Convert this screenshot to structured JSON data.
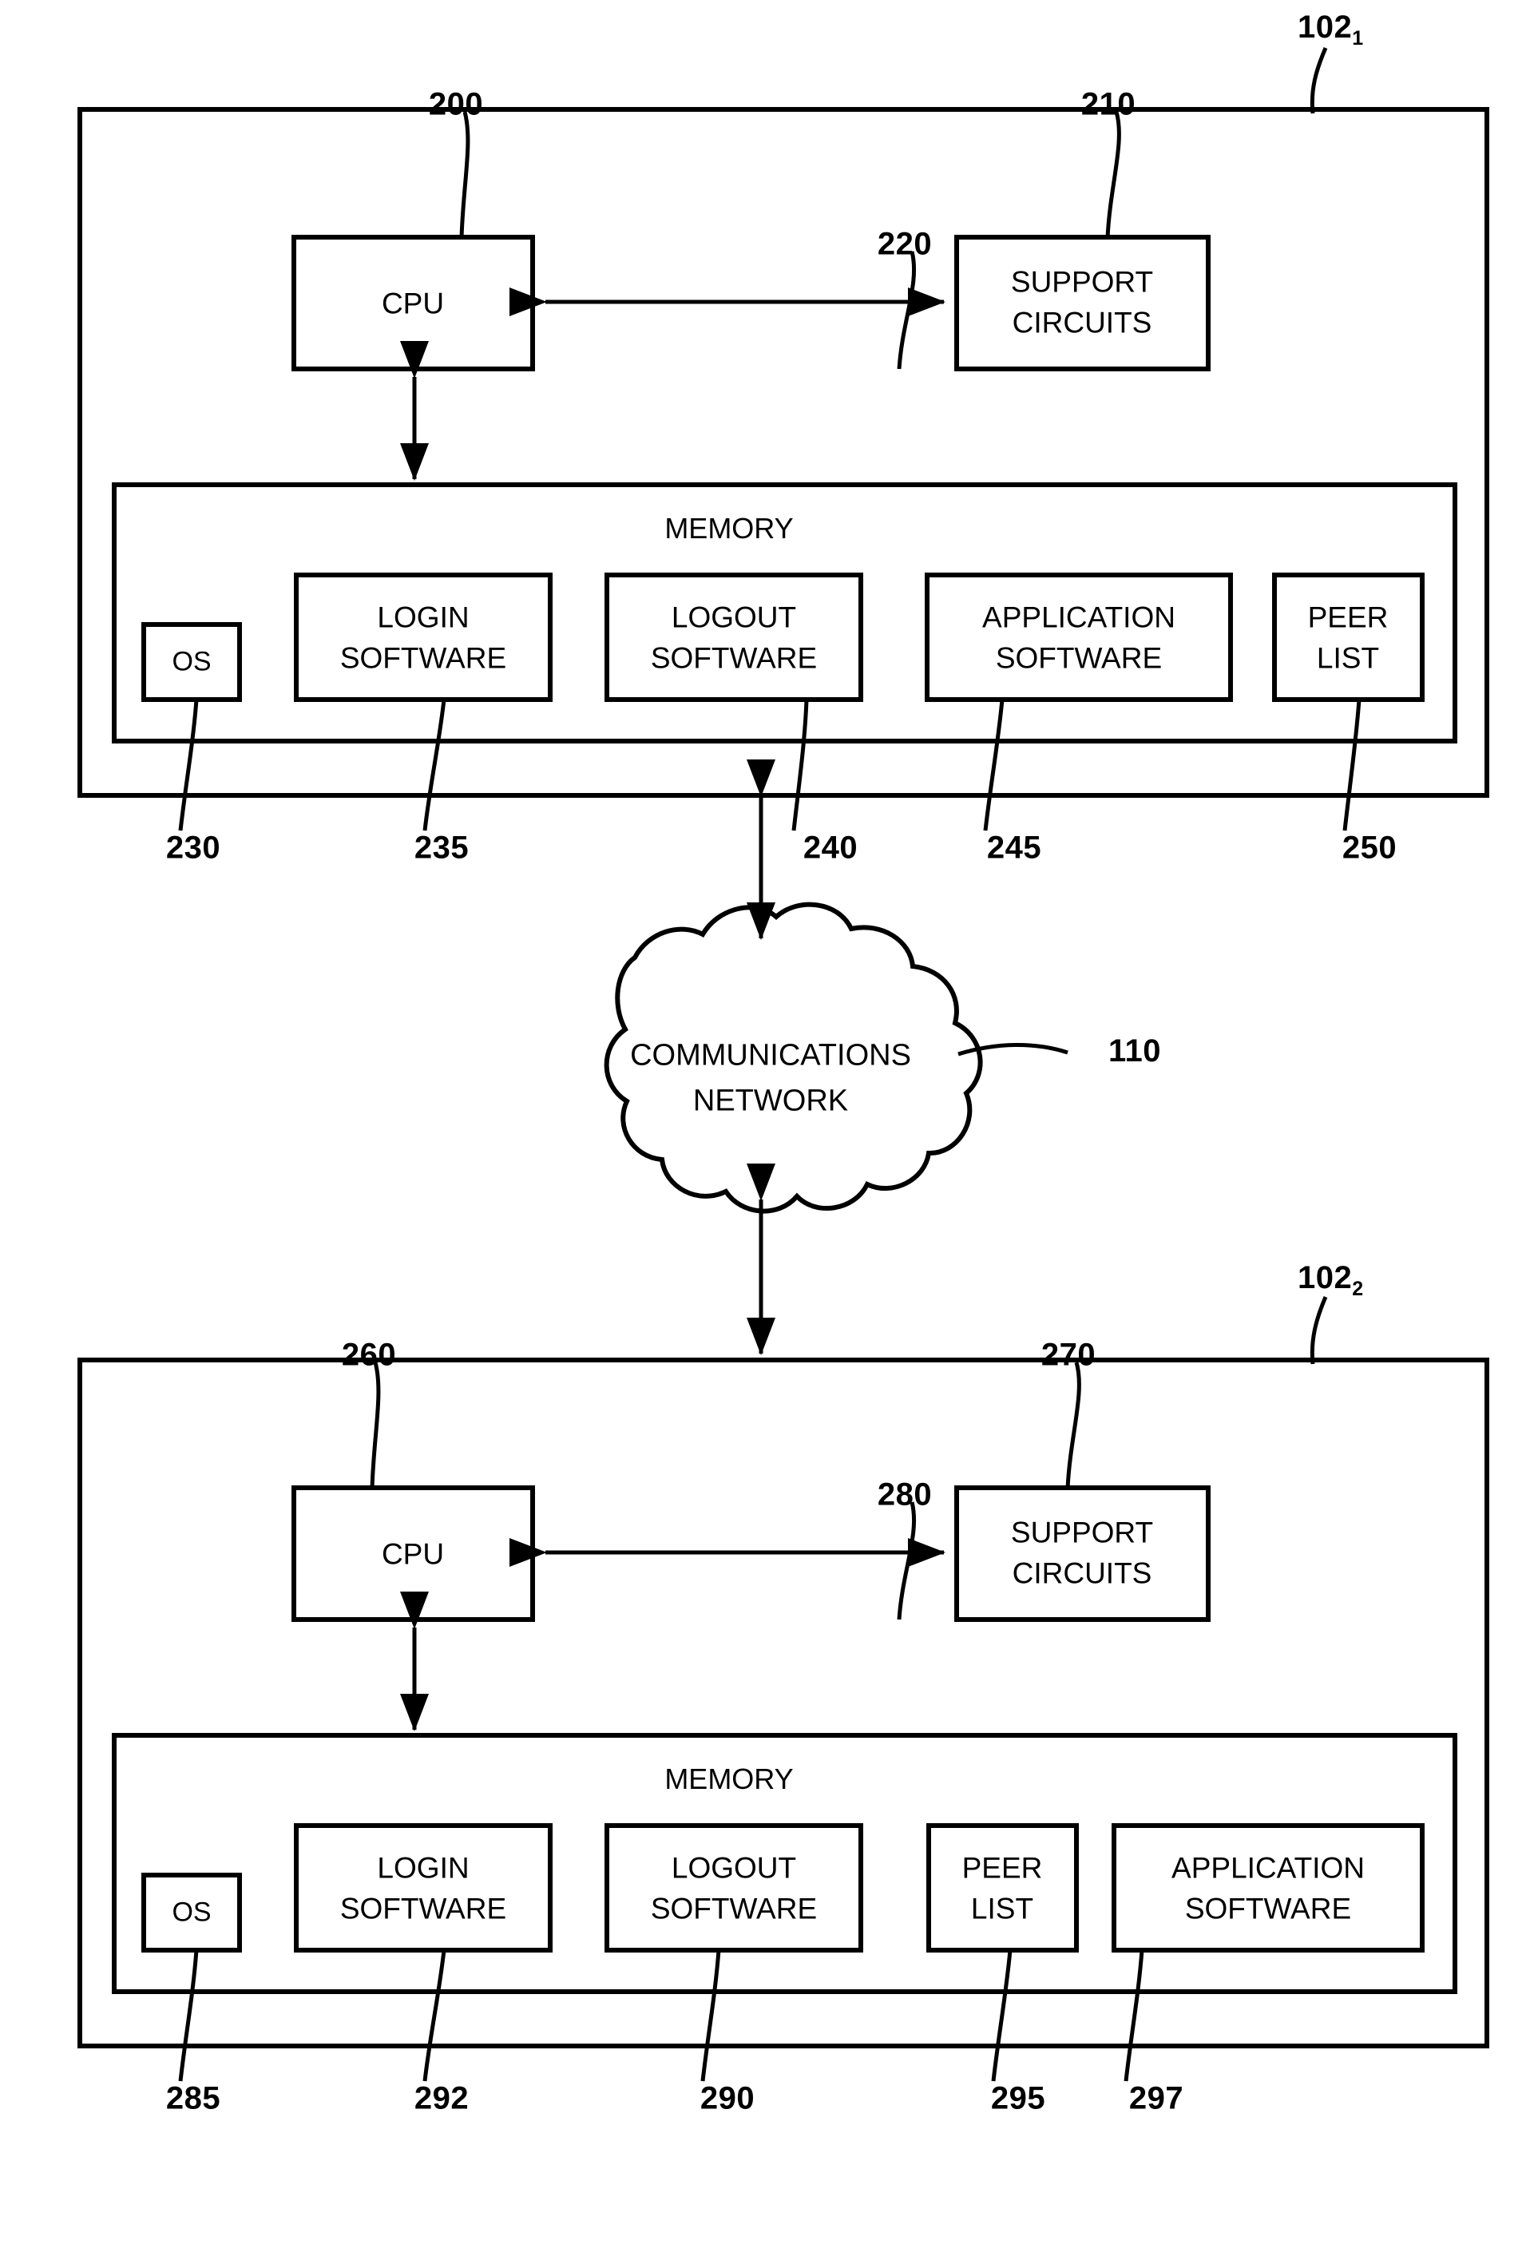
{
  "figure": {
    "type": "patent-block-diagram",
    "background": "#ffffff",
    "ink": "#000000"
  },
  "systems": [
    {
      "id": "system-1",
      "ref": "102",
      "ref_sub": "1",
      "cpu": {
        "label": "CPU",
        "ref": "200"
      },
      "support": {
        "label_line1": "SUPPORT",
        "label_line2": "CIRCUITS",
        "ref": "210"
      },
      "memory": {
        "header": "MEMORY",
        "ref": "220",
        "modules": [
          {
            "label_line1": "OS",
            "label_line2": "",
            "ref": "230"
          },
          {
            "label_line1": "LOGIN",
            "label_line2": "SOFTWARE",
            "ref": "235"
          },
          {
            "label_line1": "LOGOUT",
            "label_line2": "SOFTWARE",
            "ref": "240"
          },
          {
            "label_line1": "APPLICATION",
            "label_line2": "SOFTWARE",
            "ref": "245"
          },
          {
            "label_line1": "PEER",
            "label_line2": "LIST",
            "ref": "250"
          }
        ]
      }
    },
    {
      "id": "system-2",
      "ref": "102",
      "ref_sub": "2",
      "cpu": {
        "label": "CPU",
        "ref": "260"
      },
      "support": {
        "label_line1": "SUPPORT",
        "label_line2": "CIRCUITS",
        "ref": "270"
      },
      "memory": {
        "header": "MEMORY",
        "ref": "280",
        "modules": [
          {
            "label_line1": "OS",
            "label_line2": "",
            "ref": "285"
          },
          {
            "label_line1": "LOGIN",
            "label_line2": "SOFTWARE",
            "ref": "292"
          },
          {
            "label_line1": "LOGOUT",
            "label_line2": "SOFTWARE",
            "ref": "290"
          },
          {
            "label_line1": "PEER",
            "label_line2": "LIST",
            "ref": "295"
          },
          {
            "label_line1": "APPLICATION",
            "label_line2": "SOFTWARE",
            "ref": "297"
          }
        ]
      }
    }
  ],
  "network": {
    "label_line1": "COMMUNICATIONS",
    "label_line2": "NETWORK",
    "ref": "110"
  }
}
